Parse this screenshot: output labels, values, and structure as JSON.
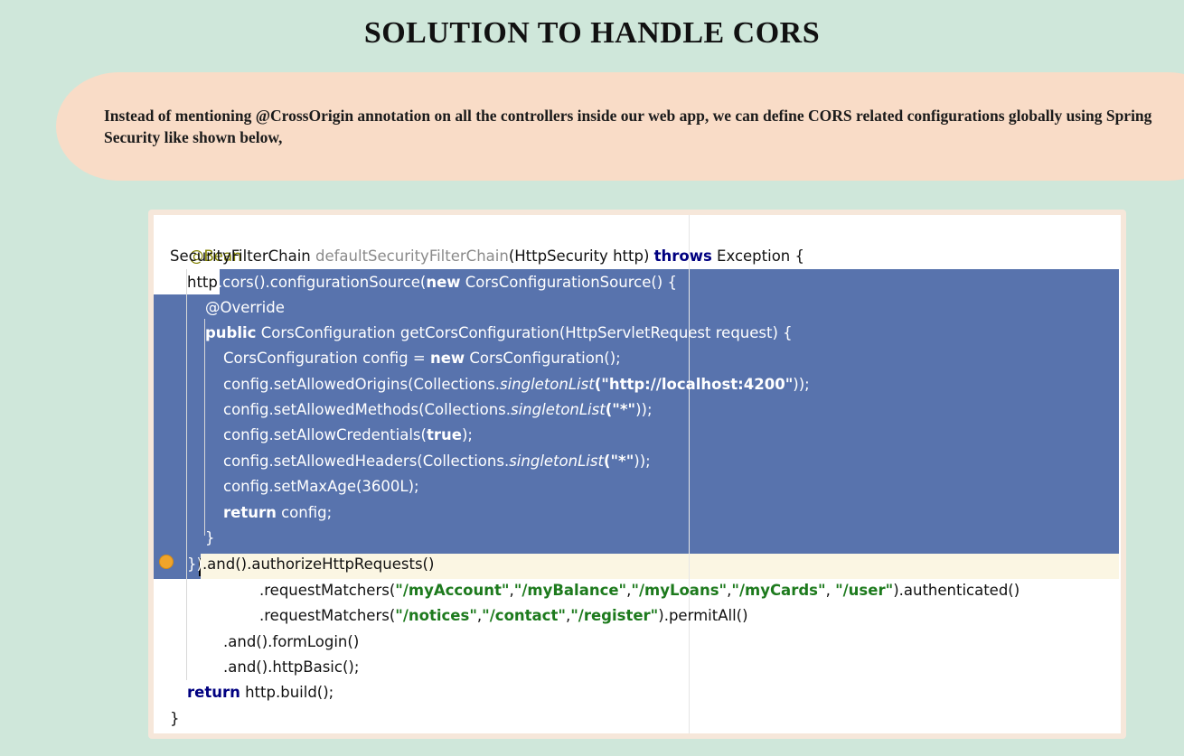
{
  "slide": {
    "title": "SOLUTION TO HANDLE CORS",
    "description": "Instead of  mentioning @CrossOrigin annotation on all the controllers inside our web app, we can define CORS related configurations globally using Spring Security like shown below,"
  },
  "code": {
    "annotation_bean": "@Bean",
    "l2_type": "SecurityFilterChain ",
    "l2_method": "defaultSecurityFilterChain",
    "l2_params": "(HttpSecurity http) ",
    "l2_throws": "throws",
    "l2_rest": " Exception {",
    "l3_http": "http",
    "l3_a": ".cors().configurationSource(",
    "l3_new": "new",
    "l3_b": " CorsConfigurationSource() {",
    "l4_override": "@Override",
    "l5_public": "public",
    "l5_rest": " CorsConfiguration getCorsConfiguration(HttpServletRequest request) {",
    "l6_a": "CorsConfiguration config = ",
    "l6_new": "new",
    "l6_b": " CorsConfiguration();",
    "l7_a": "config.setAllowedOrigins(Collections.",
    "l7_it": "singletonList",
    "l7_str": "(\"http://localhost:4200\"",
    "l7_b": "));",
    "l8_a": "config.setAllowedMethods(Collections.",
    "l8_it": "singletonList",
    "l8_str": "(\"*\"",
    "l8_b": "));",
    "l9_a": "config.setAllowCredentials(",
    "l9_true": "true",
    "l9_b": ");",
    "l10_a": "config.setAllowedHeaders(Collections.",
    "l10_it": "singletonList",
    "l10_str": "(\"*\"",
    "l10_b": "));",
    "l11": "config.setMaxAge(3600L);",
    "l12_return": "return",
    "l12_b": " config;",
    "l13": "}",
    "l14_sel": "})",
    "l14_rest": ".and().authorizeHttpRequests()",
    "l15_a": ".requestMatchers(",
    "l15_s1": "\"/myAccount\"",
    "l15_c1": ",",
    "l15_s2": "\"/myBalance\"",
    "l15_c2": ",",
    "l15_s3": "\"/myLoans\"",
    "l15_c3": ",",
    "l15_s4": "\"/myCards\"",
    "l15_c4": ", ",
    "l15_s5": "\"/user\"",
    "l15_b": ").authenticated()",
    "l16_a": ".requestMatchers(",
    "l16_s1": "\"/notices\"",
    "l16_c1": ",",
    "l16_s2": "\"/contact\"",
    "l16_c2": ",",
    "l16_s3": "\"/register\"",
    "l16_b": ").permitAll()",
    "l17": ".and().formLogin()",
    "l18": ".and().httpBasic();",
    "l19_return": "return",
    "l19_b": " http.build();",
    "l20": "}"
  },
  "colors": {
    "background": "#cfe7da",
    "callout": "#f9dcc7",
    "selection": "#5873ad",
    "keyword": "#000080",
    "string": "#1d7a1d",
    "annotation": "#808000",
    "current_line": "#fbf6e3"
  },
  "icons": {
    "gutter": "lightbulb-icon"
  }
}
